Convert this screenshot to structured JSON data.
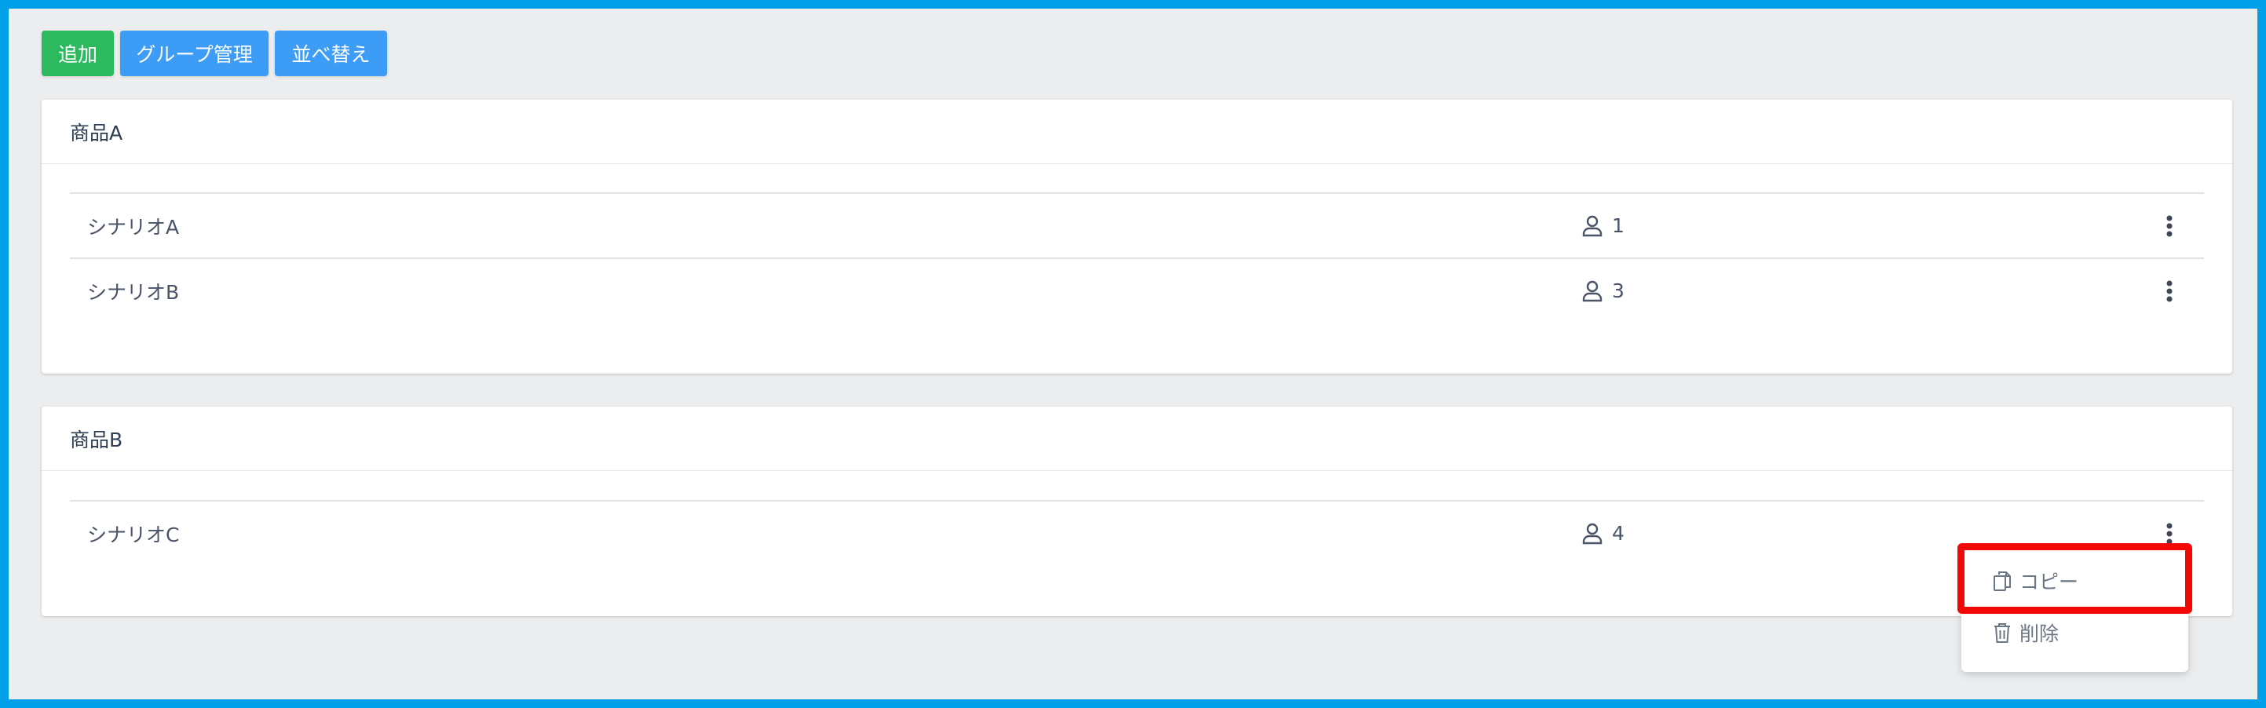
{
  "toolbar": {
    "add_label": "追加",
    "group_label": "グループ管理",
    "sort_label": "並べ替え"
  },
  "groups": [
    {
      "title": "商品A",
      "items": [
        {
          "name": "シナリオA",
          "count": "1"
        },
        {
          "name": "シナリオB",
          "count": "3"
        }
      ]
    },
    {
      "title": "商品B",
      "items": [
        {
          "name": "シナリオC",
          "count": "4"
        }
      ]
    }
  ],
  "context_menu": {
    "copy_label": "コピー",
    "delete_label": "削除"
  },
  "colors": {
    "frame_border": "#00a0e9",
    "add_button": "#2dba5e",
    "blue_button": "#3d9cf5",
    "highlight": "#f30808"
  }
}
